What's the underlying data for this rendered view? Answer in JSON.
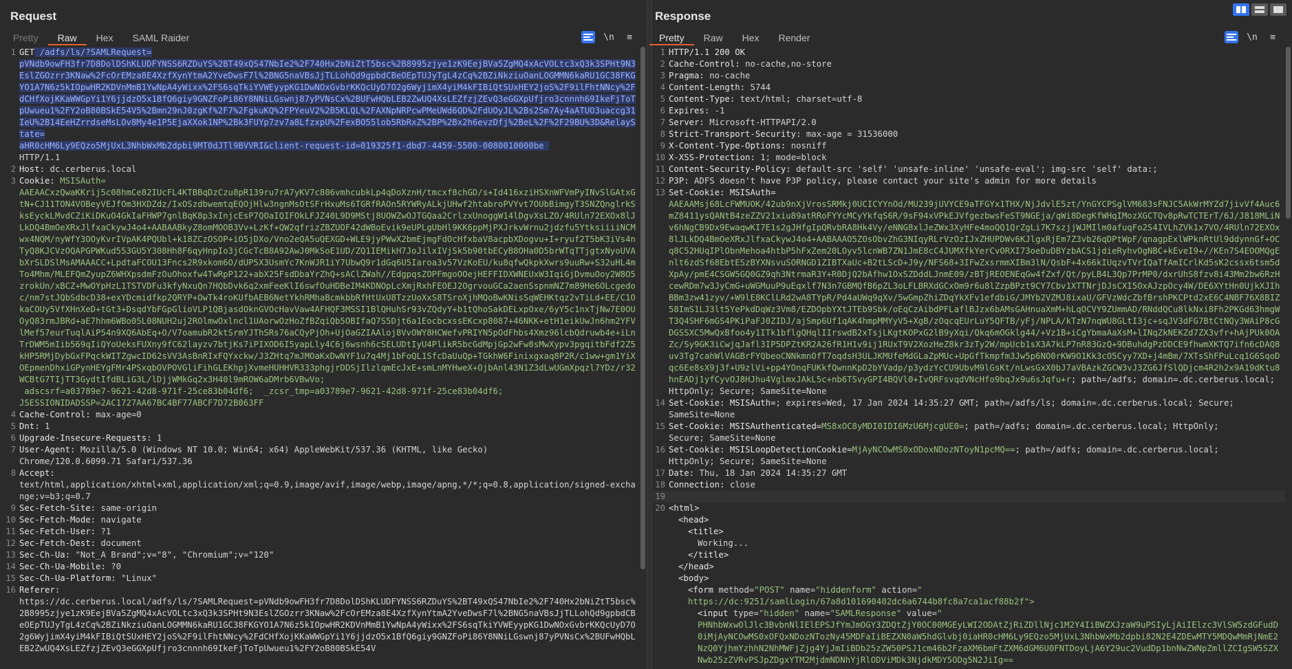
{
  "request": {
    "title": "Request",
    "tabs": [
      "Pretty",
      "Raw",
      "Hex",
      "SAML Raider"
    ],
    "active_tab": "Raw",
    "get": "GET",
    "path_sel": " /adfs/ls/?SAMLRequest=\npVNdb9owFH3fr7D8DolDShKLUDFYNSS6RZDuYS%2BT49xQS47NbIe2%2F740Hx2bNiZtT5bsc%2B8995zjye1zK9EejBVa5ZgMQ4xAcVOLtc3xQ3k3SPHt9N3EslZGOzrr3KNaw%2FcOrEMza8E4XzfXynYtmA2YveDwsF7l%2BNG5naVBsJjTLLohQd9gpbdCBeOEpTUJyTgL4zCq%2BZiNkziuOanLOGMMN6kaRU1GC38FKGYO1A7N6z5kIOpwHR2KDVnMmB1YwNpA4yWixx%2FS6sqTkiYVWEyypKG1DwNOxGvbrKKQcUyD7O2g6WyjimX4yiM4kFIBiQtSUxHEY2joS%2F9ilFhtNNcy%2FdCHfXojKKaWWGpYi1Y6jjdzO5x1BfQ6giy9GNZFoPi86Y8NNiLGswnj87yPVNsCx%2BUFwHQbLEB2ZwUQ4XsLEZfzjZEvQ3eGGXpUfjro3cnnnh69IkeFjToTpUwueu1%2FY2oB80BSkE54V5%2Bmn29nJ0zgKf%2F7%2FgkuKQ%2FPYeuV2%2B5KLQL%2FAXNpNRPcwPMeUWd6QD%2FdUOyJL%2Bs2Sm7Ay4aATUO3uaccg31IeU%2B14EeHZrrdseMsLOv8My4e1P5EjaXXok1NP%2Bk3FUYp7zv7a8LfzxpU%2FexBO55lob5RbRxZ%2BP%2Bx2h6evzDfj%2BeL%2F%2F29BU%3D&RelayState=\naHR0cHM6Ly9EQzo5MjUxL3NhbWxMb2dpbi9MT0dJTl9BVVRI&client-request-id=019325f1-dbd7-4459-5500-0080010000be ",
    "proto": "\nHTTP/1.1",
    "lines": [
      {
        "n": "2",
        "k": "Host",
        "v": "dc.cerberus.local"
      },
      {
        "n": "3",
        "k": "Cookie",
        "v": "",
        "cookies": "MSISAuth=\nAAEAACxzQwaKKrij5c08hmCe82IUcFL4KTBBqDzCzu8pR139ru7rA7yKV7c806vmhcubkLp4qDoXznH/tmcxf8chGD/s+Id416xziHSXnWFVmPyINvSlGAtxGtN+CJ11TON4VOBeyVEJfOm3HXDZdz/IxOSzdbwemtqEQOjHlw3ngnMsOtSFrHxuMs6TGRfRAOn5RYWRyALkjUHwf2htabroPVYvt7OUbBimgyT3SNZQnglrkSksEyckLMvdCZiKiDKuO4GkIaFHWP7gnlBqK8p3xInjcEsP7QOaIQIFOkLFJZ40L9D9MStj8UOWZwOJTGQaa2CrlzxUnoggW14lDgvXsLZO/4RUln72EXOx8lJLkDQ4BmOeXRxJlfxaCkywJ4o4+AABAABkyZ8omMOOB3Vv+LzKf+QW2qfrizZBZUOF42dWBoEvik9eUPLgUbHl9KK6ppMjPXJrkvWrnu2jdzfu5YtksiiiiNCMwx4NQM/nyWfY3OOyKvrIVpAK4PQUbl+k18ZCzOSOP+iO5jDXo/Vno2eQA5uQEXGD+WLE9jyPWwX2bmEjmgFdOcHfxbaV8acpbXDogvu+I+ryuf2T5bK3iVs4nTyQ8KJCVzOQAPGPWKud553GU5Y308Hh8F6qyHnpIo3jCGcTcB8A92AwJ0MkSoE1UD/ZQ1IEMikH7JoJilxIVjSk5b90tbECyB8OHa0D5brWTqTTjgtxNyoUVAbXrSLDSlMsAMAAACC+LpdtaFCOU13Fncs2R9xkom6O/dUP5X3UsmYc7KnWJR1iY7UbwQ9r1dGq6U5Iaroa3v57VzKoEU/ku8qfwQkpkXwrs9uuRw+S32uHL4mTo4Mhm/MLEFQmZyupZ6WHXpsdmFzOuOhoxfw4TwRpP122+abX25FsdDbaYrZhQ+sAClZWah//EdgpqsZOPFmgoOOejHEFFIDXWNEUxW3IqiGjDvmuOoy2W8O5zrokUn/xBCZ+MwOYpHzL1TSTVDFu3kfyNxuQn7HQbDvk6q2xmFeeKlI6swfOuHDBeIM4KDNOpLcXmjRxhFEOEJ2OgrvouGCa2aenSspnmNZ7m89He6OLcgedoc/nm7stJQbSdbcD38+exYDcmidfkp2QRYP+OwTk4roKUfbAEB6NetYkhRMhaBcmkbbRfHtUxU8TzzUoXxS8TSroXjhMQoBwKNisSqWEHKtqz2vTiLd+EE/C1OkaCOUy5VfXHnXeD+tGt3+DsqdYbFGpGlioVLP1QBjasdOknGVOcHavVaw4AFHQF3MSSI1BlQHuhSr93vZQdyY+b1tQhoSakDELxpOxe/6yY5c1nxTjNw7E0OUOyQ83rmJBRd+aE7hhm6WBo05L08NUH2uj2ROlmwOxlncl1UAorwOzHoZfBZqiQb5OBIfaQ7S5Djt6a1EocbcxssEKcxp8087+46NKK+etH1eikUwJn6hm2YFVlMef57eurTuqlAiP54n9XQ6AbEq+O/V7oamubR2ktSrmYJThSRs76aCQyPjOh+UjOaGZIAAloj8VvOWY8HCWefvPRIYN5pOdFhbs4Xmz96lcbQdruwb4e+iLnTrDWM5mIib569qIiQYoUeksFUXny9fC62layzv7btjKs7iPIXOD6I5yapLly4C6j6wsnh6cSELUDtIyU4PlikR5bcGdMpjGp2wFw8sMwXypv3pgqitbFdf2Z5kHP5RMjDybGxFPqckWITZgwcID62sVV3AsBnRIxFQYxckw/J3ZHtq7mJMOaKxDwNYF1u7q4Mj1bFoQL1SfcDaUuQp+TGkhW6Finixgxaq8P2R/c1ww+gm1YiXOEpmenDhxiGPynHEYgFMr4PSxqbOVPOVGliFihGLEKhpjXvmeHUHHVR333phgjrDDSjIlzlqmEcJxE+smLnMYHweX+OjbAnl43N1Z3dLwUGmXpqzl7YDz/r32WCBtG7TIjTT3GydtIfdBLiG3L/lDjjWMkGq2x3H40l9mROW6aDMrb6VBwVo;"
      },
      {
        "n": "",
        "k": "",
        "v": " adscsrf=a03789e7-9621-42d8-971f-25ce83b04df6;  _zcsr_tmp=a03789e7-9621-42d8-971f-25ce83b04df6;\nJSESSIONIDADSSP=2AC1727AA67BC4BF77ABCF7D72B063FF",
        "tail": true
      },
      {
        "n": "4",
        "k": "Cache-Control",
        "v": "max-age=0"
      },
      {
        "n": "5",
        "k": "Dnt",
        "v": "1"
      },
      {
        "n": "6",
        "k": "Upgrade-Insecure-Requests",
        "v": "1"
      },
      {
        "n": "7",
        "k": "User-Agent",
        "v": "Mozilla/5.0 (Windows NT 10.0; Win64; x64) AppleWebKit/537.36 (KHTML, like Gecko)\nChrome/120.0.6099.71 Safari/537.36"
      },
      {
        "n": "8",
        "k": "Accept",
        "v": "\ntext/html,application/xhtml+xml,application/xml;q=0.9,image/avif,image/webp,image/apng,*/*;q=0.8,application/signed-exchange;v=b3;q=0.7"
      },
      {
        "n": "9",
        "k": "Sec-Fetch-Site",
        "v": "same-origin"
      },
      {
        "n": "10",
        "k": "Sec-Fetch-Mode",
        "v": "navigate"
      },
      {
        "n": "11",
        "k": "Sec-Fetch-User",
        "v": "?1"
      },
      {
        "n": "12",
        "k": "Sec-Fetch-Dest",
        "v": "document"
      },
      {
        "n": "13",
        "k": "Sec-Ch-Ua",
        "v": "\"Not_A Brand\";v=\"8\", \"Chromium\";v=\"120\""
      },
      {
        "n": "14",
        "k": "Sec-Ch-Ua-Mobile",
        "v": "?0"
      },
      {
        "n": "15",
        "k": "Sec-Ch-Ua-Platform",
        "v": "\"Linux\""
      },
      {
        "n": "16",
        "k": "Referer",
        "v": "\nhttps://dc.cerberus.local/adfs/ls/?SAMLRequest=pVNdb9owFH3fr7D8DolDShKLUDFYNSS6RZDuYS%2BT49xQS47NbIe2%2F740Hx2bNiZtT5bsc%2B8995zjye1zK9EejBVa5ZgMQ4xAcVOLtc3xQ3k3SPHt9N3EslZGOzrr3KNaw%2FcOrEMza8E4XzfXynYtmA2YveDwsF7l%2BNG5naVBsJjTLLohQd9gpbdCBeOEpTUJyTgL4zCq%2BZiNkziuOanLOGMMN6kaRU1GC38FKGYO1A7N6z5kIOpwHR2KDVnMmB1YwNpA4yWixx%2FS6sqTkiYVWEyypKG1DwNOxGvbrKKQcUyD7O2g6WyjimX4yiM4kFIBiQtSUxHEY2joS%2F9ilFhtNNcy%2FdCHfXojKKaWWGpYi1Y6jjdzO5x1BfQ6giy9GNZFoPi86Y8NNiLGswnj87yPVNsCx%2BUFwHQbLEB2ZwUQ4XsLEZfzjZEvQ3eGGXpUfjro3cnnnh69IkeFjToTpUwueu1%2FY2oB80BSkE54V"
      }
    ]
  },
  "response": {
    "title": "Response",
    "tabs": [
      "Pretty",
      "Raw",
      "Hex",
      "Render"
    ],
    "active_tab": "Pretty",
    "lines": [
      {
        "n": "1",
        "raw": "HTTP/1.1 200 OK"
      },
      {
        "n": "2",
        "k": "Cache-Control",
        "v": "no-cache,no-store"
      },
      {
        "n": "3",
        "k": "Pragma",
        "v": "no-cache"
      },
      {
        "n": "4",
        "k": "Content-Length",
        "v": "5744"
      },
      {
        "n": "5",
        "k": "Content-Type",
        "v": "text/html; charset=utf-8"
      },
      {
        "n": "6",
        "k": "Expires",
        "v": "-1"
      },
      {
        "n": "7",
        "k": "Server",
        "v": "Microsoft-HTTPAPI/2.0"
      },
      {
        "n": "8",
        "k": "Strict-Transport-Security",
        "v": "max-age = 31536000"
      },
      {
        "n": "9",
        "k": "X-Content-Type-Options",
        "v": "nosniff"
      },
      {
        "n": "10",
        "k": "X-XSS-Protection",
        "v": "1; mode=block"
      },
      {
        "n": "11",
        "k": "Content-Security-Policy",
        "v": "default-src 'self' 'unsafe-inline' 'unsafe-eval'; img-src 'self' data:;"
      },
      {
        "n": "12",
        "k": "P3P",
        "v": "ADFS doesn't have P3P policy, please contact your site's admin for more details"
      },
      {
        "n": "13",
        "k": "Set-Cookie",
        "cname": "MSISAuth",
        "cval": "\nAAEAAMsj68LcFWMUOK/42ub9nXjVrosSRMkj0UCICYYnOd/MU239jUVYCE9aTFGYx1THX/NjJdvlE5zt/YnGYCPSglVM683sFNJC5AkWrMYZd7jivVf4Auc6mZ8411ysQANtB4zeZZV21xiu89atRRoFYYcMCyYkfqS6R/9sF94xVPkEJVfgezbwsFeST9NGEja/qWi8DegKfWHqIMozXGCTQv8pRwTCTErT/6J/J818MLiNv6hNgCB9Dx9EwaqwKI7E1s2gJHfgIpQRvbRA8Hk4Vy/eNNG8xlJeZWx3XyHFe4moQQ1QrZgLi7K7szjjWJMIlm0afuqFo2S4IVLhZVk1x7VO/4RUln72EXOx8lJLkDQ4BmOeXRxJlfxaCkywJ4o4+AABAAAO5ZOsObvZhG3NIqyRLrVzOzIJxZHUPDWv6KJlgxRjEm7Z3vb26qDPtWpF/qnagpExlWPknRtUl9ddynnGf+OCq8C52HUqIPlObnMehoa4htbP5hFxZem20LOyv5lcnWB7ZN1JmE8cC4JUMXfkYerCvORXI73oeDuDBYzbACS1jdieRyhvOgNBC+kEveI9+//KEn7S4EOOMQgEnlt6zdSf68EbtESzBYXNsvuSORNGD1ZIBTXaUc+B2tLScD+J9y/NFS68+3IFwZxsrmmXIBm3lN/QsbF+4x66kIUqzvTVrIQaTfAmICrlKd5sK2cssx6tsm5dXpAy/pmE4CSGW5GQ0GZ9qh3NtrmaR3Y+R0DjQ2bAfhw1OxSZDddLJnmE09/zBTjREOENEqGw4fZxf/Qt/pyLB4L3Qp7PrMP0/dxrUhS8fzv8i43Mm2bw6RzHcewRDm7w3JyCmG+uWGMuuP9uEqxlf7N3n7GBMQfB6pZL3oLFLBRXdGCxOm9r6u8lZzpBPzt9CY7Cbv1XTTNrjDJsCXI5OxAJzpOcy4W/DE6XYtHn0UjkXJIhBBm3zw41zyv/+W9lE8KClLRd2wA8TYpR/Pd4aUWq9qXv/5wGmpZhiZDqYkXFv1efdbiG/JMYb2VZMJ8ixaU/GFVzWdcZbfBrshPKCPtd2xE6C4NBF76X8BIZ58ImS1LJ3lt5YePkdDqWz3Vm8/EZDOpbYXtJTEb9Sbk/oEqCzAibdPFLaflBJzx6bAMsGAHnuaXmM+hLqOCVY9ZUmmAD/RNddQCu8lkNxi8Fh2PKGd63hmgWT3Q4SHF6mGS4PKiPaFJ0ZIDJ/ajSmp6Uf1qAK4hmpMMYyV5+XgB/zOqcqEUrLuY5QFTB/yFj/NPLA/kTzN7nqWU8GLtI3jc+sqJV3dFG7BtCtNQy3WAiP8cGDGSSXC5MwQxBfoo4y1ITk1bflgQHqlIIrswdB2xTsjLKgtKOPxG2lB9yXqi/Qkq6mOGklg44/+Vz1B+iCgYbmaAaXsM+lINqZkNEKZd7ZX3vfr+hAjPUk0OAZc/Sy9GK3iCwjqJafl3IP5DPZtKR2A26fR1H1v9ij1RUxT9V2XozHeZ8kr3zTy2W/mpUcb1sX3A7kLP7nR83GzQ+9DBuhdgPzDDCE9fhwmXKTQ7ifn6cDAQ8uv3Tg7cahWlVAGBrFYQbeoCNNkmnOfT7oqdsH3ULJKMUfeMdGLaZpMUc+UpGfTkmpfm3Jw5p6NO0rKW9O1Kk3cO5Cyy7XD+j4mBm/7XTsShFPuLcq1G6SqoDqc6Ee8sX9j3f+U9zlVi+pp4YOnqFUKkfQwnnKpD2bYVadp/p3ydzYcCU9UbvM9lGsKt/nLwsGxX0bJ7aVBAzkZGCW3vJ3ZG6JfSlQDjcm4R2h2x9A19dKtu8hnEADj1yfCyvOJ8HJhu4VglmxJAkL5c+nb6TSvyGPI4BQVl0+IvQRFsvqdVNcHfo9bqJx9u6sJqfu+r",
        "tail": "; path=/adfs; domain=.dc.cerberus.local; HttpOnly; Secure; SameSite=None"
      },
      {
        "n": "14",
        "k": "Set-Cookie",
        "cname": "MSISAuth",
        "cval": "",
        "tail": "; expires=Wed, 17 Jan 2024 14:35:27 GMT; path=/adfs/ls; domain=.dc.cerberus.local; Secure;\nSameSite=None"
      },
      {
        "n": "15",
        "k": "Set-Cookie",
        "cname": "MSISAuthenticated",
        "cval": "MS8xOC8yMDI0IDI6MzU6MjcgUE0=",
        "tail": "; path=/adfs; domain=.dc.cerberus.local; HttpOnly;\nSecure; SameSite=None"
      },
      {
        "n": "16",
        "k": "Set-Cookie",
        "cname": "MSISLoopDetectionCookie",
        "cval": "MjAyNCOwMS0xODoxNDozNToyN1pcMQ==",
        "tail": "; path=/adfs; domain=.dc.cerberus.local;\nHttpOnly; Secure; SameSite=None"
      },
      {
        "n": "17",
        "k": "Date",
        "v": "Thu, 18 Jan 2024 14:35:27 GMT"
      },
      {
        "n": "18",
        "k": "Connection",
        "v": "close"
      },
      {
        "n": "19",
        "raw": "",
        "current": true
      },
      {
        "n": "20",
        "html": [
          {
            "t": "<html>",
            "i": 0
          }
        ]
      },
      {
        "n": "",
        "html": [
          {
            "t": "<head>",
            "i": 1
          }
        ]
      },
      {
        "n": "",
        "html": [
          {
            "t": "<title>",
            "i": 2
          }
        ]
      },
      {
        "n": "",
        "text": "Working...",
        "i": 3
      },
      {
        "n": "",
        "html": [
          {
            "t": "</title>",
            "i": 2
          }
        ]
      },
      {
        "n": "",
        "html": [
          {
            "t": "</head>",
            "i": 1
          }
        ]
      },
      {
        "n": "",
        "html": [
          {
            "t": "<body>",
            "i": 1
          }
        ]
      },
      {
        "n": "",
        "form": true,
        "i": 2,
        "method": "\"POST\"",
        "name": "\"hiddenform\"",
        "action": "\"",
        "action_cont": "https://dc:9251/samlLogin/67a8d101690402dc6a6744b8fc8a7ca1acf88b2f\">"
      },
      {
        "n": "",
        "input": true,
        "i": 3,
        "type": "\"hidden\"",
        "name": "\"SAMLResponse\"",
        "value": "\"",
        "value_cont": "PHNhbWxwOlJlc3BvbnNlIElEPSJfYmJmOGY3ZDQtZjY0OC00MGEyLWI2ODAtZjRiZDllNjc1M2Y4IiBWZXJzaW9uPSIyLjAiIElzc3VlSW5zdGFudD0iMjAyNCOwMS0xOFQxNDozNTozNy45MDFaIiBEZXN0aW5hdGlvbj0iaHR0cHM6Ly9EQzo5MjUxL3NhbWxMb2dpbi82N2E4ZDEwMTY5MDQwMmRjNmE2NzQ0YjhmYzhhN2NhMWFjZjg4YjJmIiBDb25zZW50PSJ1cm46b2FzaXM6bmFtZXM6dGM6U0FNTDoyLjA6Y29uc2VudDp1bnNwZWNpZmllZCIgSW5SZXNwb25zZVRvPSJpZDgxYTM2MjdmNDNhYjRlODViMDk3NjdkMDY5ODg5N2JiIg=="
      }
    ]
  },
  "toolbar": {
    "newline_label": "\\n",
    "menu_label": "≡"
  },
  "colors": {
    "accent": "#e8602c",
    "blue": "#3574f0",
    "selection": "#2f3a66",
    "value_green": "#9bc37f"
  }
}
